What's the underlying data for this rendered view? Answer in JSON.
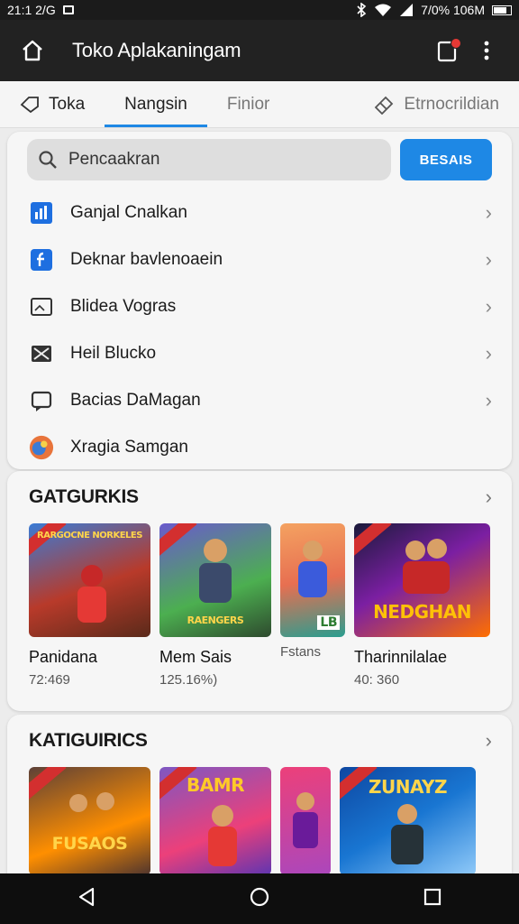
{
  "status": {
    "time": "21:1 2/G",
    "battery_text": "7/0% 106M"
  },
  "appbar": {
    "title": "Toko Aplakaningam"
  },
  "tabs": [
    {
      "label": "Toka"
    },
    {
      "label": "Nangsin"
    },
    {
      "label": "Finior"
    },
    {
      "label": "Etrnocrildian"
    }
  ],
  "search": {
    "placeholder": "Pencaakran",
    "button": "BESAIS"
  },
  "menu": [
    {
      "label": "Ganjal Cnalkan"
    },
    {
      "label": "Deknar bavlenoaein"
    },
    {
      "label": "Blidea Vogras"
    },
    {
      "label": "Heil Blucko"
    },
    {
      "label": "Bacias DaMagan"
    },
    {
      "label": "Xragia Samgan"
    }
  ],
  "section1": {
    "title": "GATGURKIS",
    "tiles": [
      {
        "name": "Panidana",
        "meta": "72:469",
        "caption": "RARGOCNE NORKELES"
      },
      {
        "name": "Mem Sais",
        "meta": "125.16%)",
        "caption": "RAENGERS"
      },
      {
        "name": "",
        "meta": "Fstans",
        "caption": "LB"
      },
      {
        "name": "Tharinnilalae",
        "meta": "40: 360",
        "caption": "NEDGHAN"
      }
    ]
  },
  "section2": {
    "title": "KATIGUIRICS",
    "tiles": [
      {
        "caption": "FUSAOS"
      },
      {
        "caption": "BAMR"
      },
      {
        "caption": ""
      },
      {
        "caption": "ZUNAYZ"
      }
    ]
  },
  "colors": {
    "accent": "#1e88e5",
    "appbar": "#222222",
    "navbar": "#0e0e0e"
  }
}
